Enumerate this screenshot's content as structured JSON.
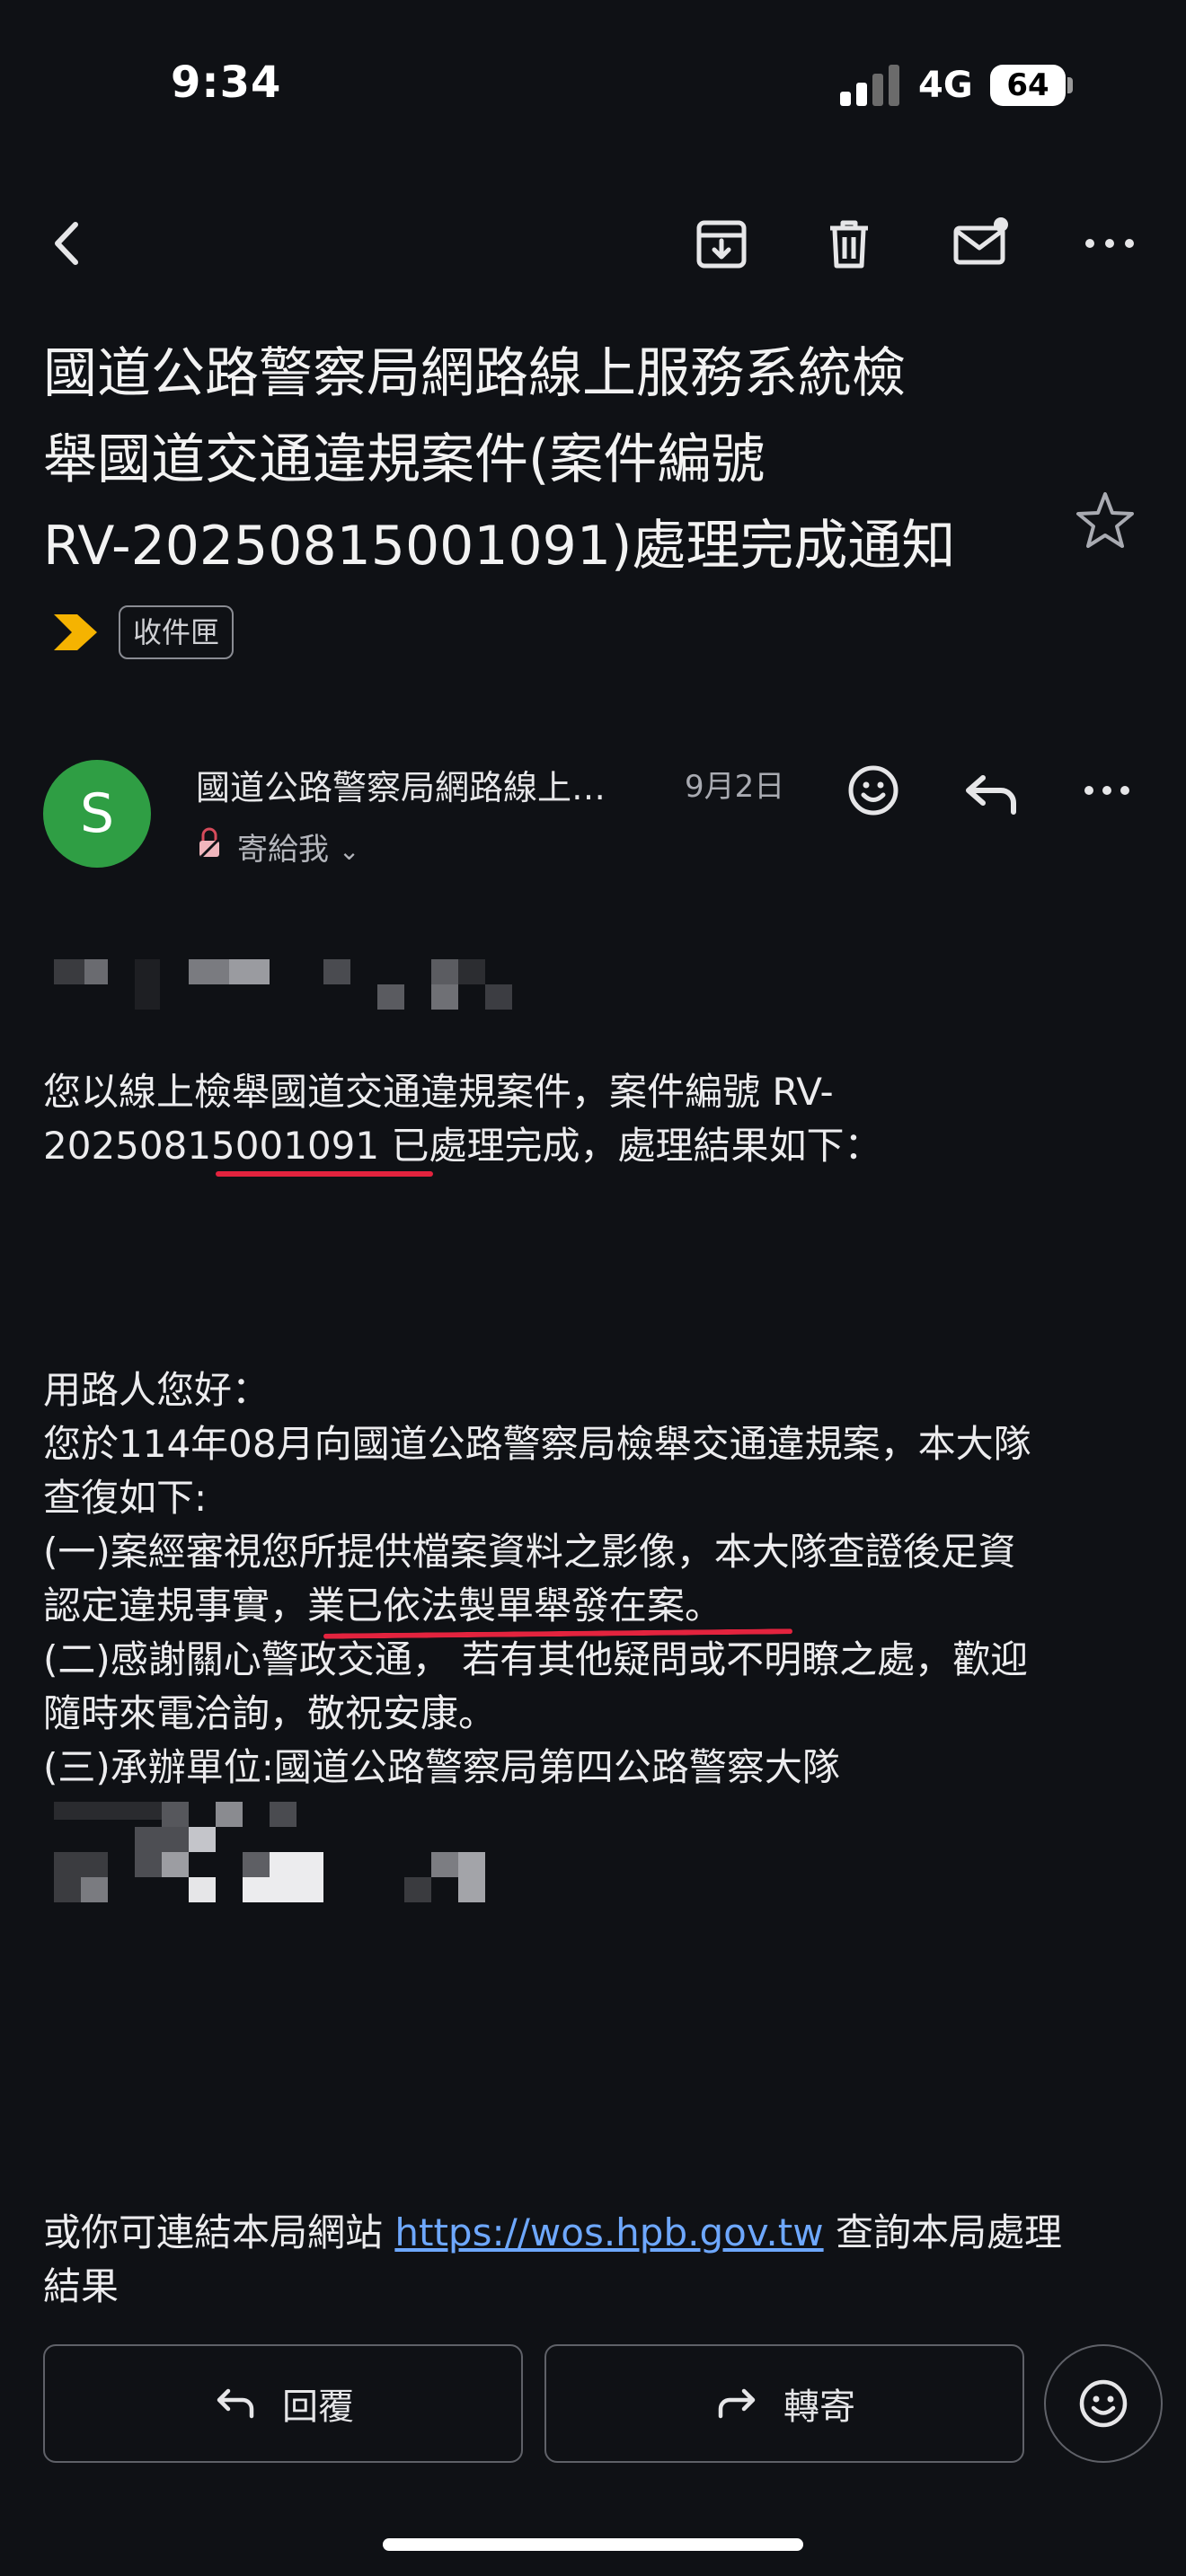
{
  "status": {
    "time": "9:34",
    "network": "4G",
    "battery": "64"
  },
  "toolbar": {
    "back": "back-icon",
    "archive": "archive-icon",
    "delete": "trash-icon",
    "mark_unread": "mail-unread-icon",
    "more": "more-icon"
  },
  "email": {
    "subject_lines": [
      "國道公路警察局網路線上服務系統檢",
      "舉國道交通違規案件(案件編號",
      "RV-20250815001091)處理完成通知"
    ],
    "label": "收件匣",
    "sender": {
      "initial": "S",
      "name": "國道公路警察局網路線上…",
      "date": "9月2日",
      "to": "寄給我"
    },
    "body": {
      "intro_lines": [
        "您以線上檢舉國道交通違規案件，案件編號 RV-",
        "20250815001091 已處理完成，處理結果如下："
      ],
      "result_lines": [
        "用路人您好：",
        "您於114年08月向國道公路警察局檢舉交通違規案，本大隊",
        "查復如下:",
        "(一)案經審視您所提供檔案資料之影像，本大隊查證後足資",
        "認定違規事實，業已依法製單舉發在案。",
        "(二)感謝關心警政交通， 若有其他疑問或不明瞭之處，歡迎",
        "隨時來電洽詢，敬祝安康。",
        "(三)承辦單位:國道公路警察局第四公路警察大隊"
      ],
      "footer_prefix": "或你可連結本局網站 ",
      "footer_link": "https://wos.hpb.gov.tw",
      "footer_suffix": " 查詢本局處理",
      "footer_line2": "結果"
    }
  },
  "actions": {
    "reply": "回覆",
    "forward": "轉寄"
  },
  "colors": {
    "background": "#0f1115",
    "avatar": "#2f9e44",
    "label_arrow": "#f5b301",
    "annotation": "#e3233e",
    "link": "#6ea8ff"
  }
}
